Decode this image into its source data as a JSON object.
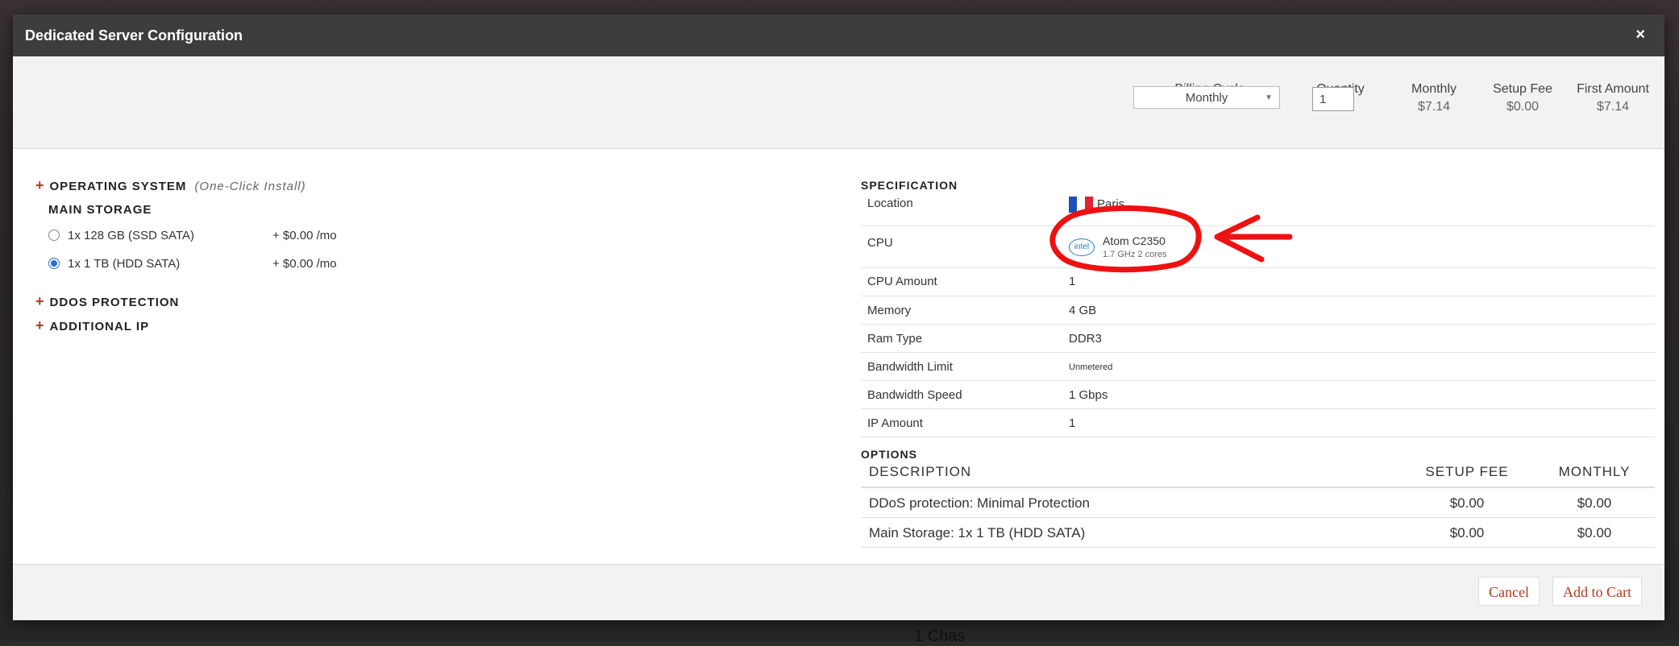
{
  "modal": {
    "title": "Dedicated Server Configuration",
    "close_label": "×"
  },
  "summary": {
    "billing_cycle_label": "Billing Cycle",
    "billing_cycle_value": "Monthly",
    "quantity_label": "Quantity",
    "quantity_value": "1",
    "monthly_label": "Monthly",
    "monthly_value": "$7.14",
    "setup_fee_label": "Setup Fee",
    "setup_fee_value": "$0.00",
    "first_amount_label": "First Amount",
    "first_amount_value": "$7.14"
  },
  "left": {
    "operating_system_label": "OPERATING SYSTEM",
    "operating_system_note": "(One-Click Install)",
    "main_storage_label": "MAIN STORAGE",
    "storage_options": [
      {
        "label": "1x 128 GB (SSD SATA)",
        "price": "+ $0.00 /mo",
        "selected": false
      },
      {
        "label": "1x 1 TB (HDD SATA)",
        "price": "+ $0.00 /mo",
        "selected": true
      }
    ],
    "ddos_label": "DDOS PROTECTION",
    "additional_ip_label": "ADDITIONAL IP"
  },
  "spec": {
    "title": "SPECIFICATION",
    "location_label": "Location",
    "location_value": "Paris",
    "cpu_label": "CPU",
    "cpu_logo_text": "intel",
    "cpu_name": "Atom C2350",
    "cpu_detail": "1.7 GHz 2 cores",
    "cpu_amount_label": "CPU Amount",
    "cpu_amount_value": "1",
    "memory_label": "Memory",
    "memory_value": "4 GB",
    "ram_type_label": "Ram Type",
    "ram_type_value": "DDR3",
    "bandwidth_limit_label": "Bandwidth Limit",
    "bandwidth_limit_value": "Unmetered",
    "bandwidth_speed_label": "Bandwidth Speed",
    "bandwidth_speed_value": "1 Gbps",
    "ip_amount_label": "IP Amount",
    "ip_amount_value": "1"
  },
  "options": {
    "title": "OPTIONS",
    "headers": [
      "DESCRIPTION",
      "SETUP FEE",
      "MONTHLY"
    ],
    "rows": [
      [
        "DDoS protection: Minimal Protection",
        "$0.00",
        "$0.00"
      ],
      [
        "Main Storage: 1x 1 TB (HDD SATA)",
        "$0.00",
        "$0.00"
      ]
    ]
  },
  "footer": {
    "cancel_label": "Cancel",
    "add_to_cart_label": "Add to Cart"
  },
  "background": {
    "partial_text": "1 Chas"
  },
  "colors": {
    "accent": "#b33a1a",
    "header_bg": "#3d3d3d",
    "annotation": "#ee1111"
  }
}
